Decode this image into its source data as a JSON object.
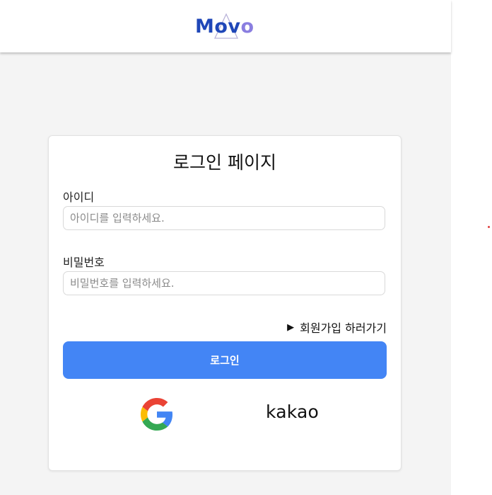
{
  "header": {
    "logo_text": "Movo",
    "logo_color": "#1f47b8"
  },
  "login": {
    "title": "로그인 페이지",
    "id_label": "아이디",
    "id_placeholder": "아이디를 입력하세요.",
    "id_value": "",
    "password_label": "비밀번호",
    "password_placeholder": "비밀번호를 입력하세요.",
    "password_value": "",
    "signup_link": "회원가입 하러가기",
    "submit_label": "로그인",
    "submit_color": "#4385f5"
  },
  "social": {
    "google_icon": "google-g-logo",
    "kakao_label": "kakao"
  }
}
